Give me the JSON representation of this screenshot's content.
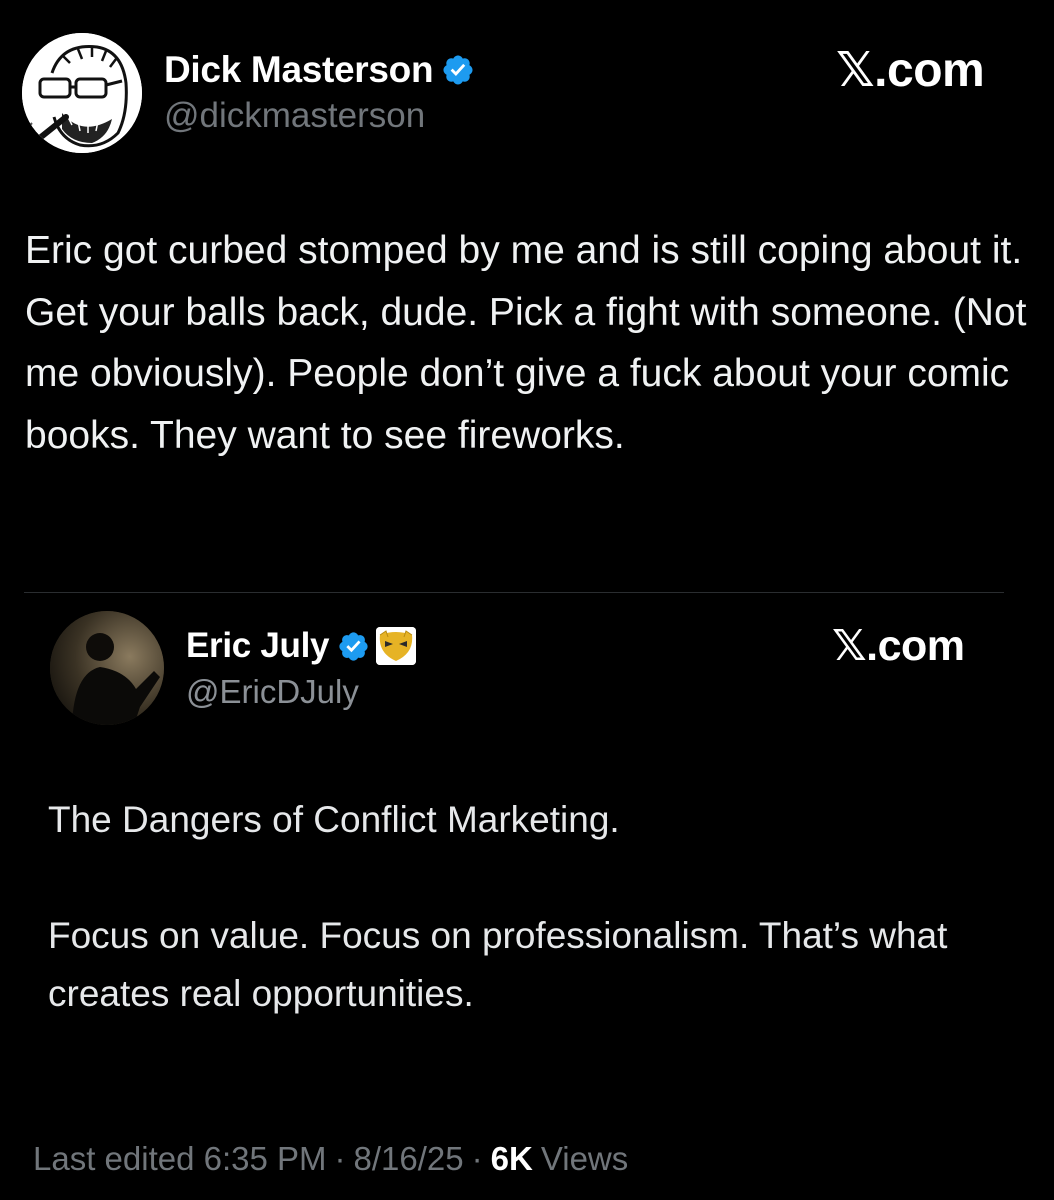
{
  "main_tweet": {
    "author_name": "Dick Masterson",
    "handle": "@dickmasterson",
    "brand": "𝕏.com",
    "verified_icon": "verified-badge-icon",
    "text": "Eric got curbed stomped by me and is still coping about it. Get your balls back, dude. Pick a fight with someone. (Not me obviously). People don’t give a fuck about your comic books. They want to see fireworks."
  },
  "quoted_tweet": {
    "author_name": "Eric July",
    "handle": "@EricDJuly",
    "brand": "𝕏.com",
    "verified_icon": "verified-badge-icon",
    "affiliate_icon": "affiliate-mask-icon",
    "paragraphs": [
      "The Dangers of Conflict Marketing.",
      "Focus on value. Focus on professionalism. That’s what creates real opportunities."
    ]
  },
  "footer": {
    "edited_label": "Last edited 6:35 PM",
    "separator": "·",
    "date": "8/16/25",
    "views_count": "6K",
    "views_label": "Views"
  },
  "colors": {
    "background": "#000000",
    "primary_text": "#e7e9ea",
    "secondary_text": "#71767b",
    "verified_blue": "#1d9bf0",
    "affiliate_gold": "#e6b325"
  }
}
